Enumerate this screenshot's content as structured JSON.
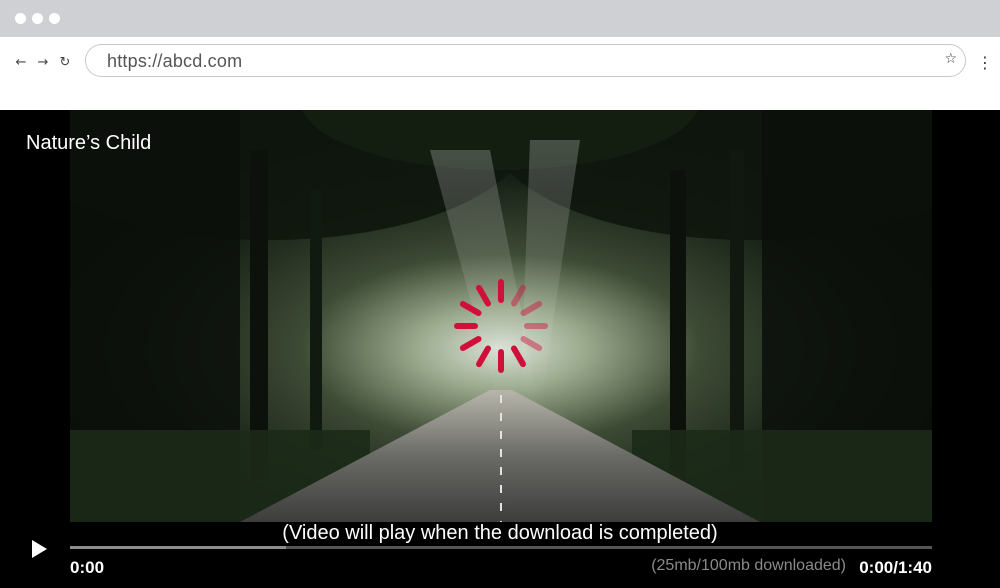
{
  "browser": {
    "url": "https://abcd.com",
    "back_icon": "←",
    "forward_icon": "→",
    "reload_icon": "↻",
    "star_icon": "☆",
    "menu_icon": "⋮"
  },
  "player": {
    "title": "Nature’s Child",
    "caption": "(Video will play when the download is completed)",
    "current_time": "0:00",
    "download_status": "(25mb/100mb downloaded)",
    "time_display": "0:00/1:40",
    "downloaded_fraction": 0.25,
    "spinner_color": "#d1103a",
    "icons": [
      "play-icon",
      "loading-spinner-icon"
    ]
  }
}
